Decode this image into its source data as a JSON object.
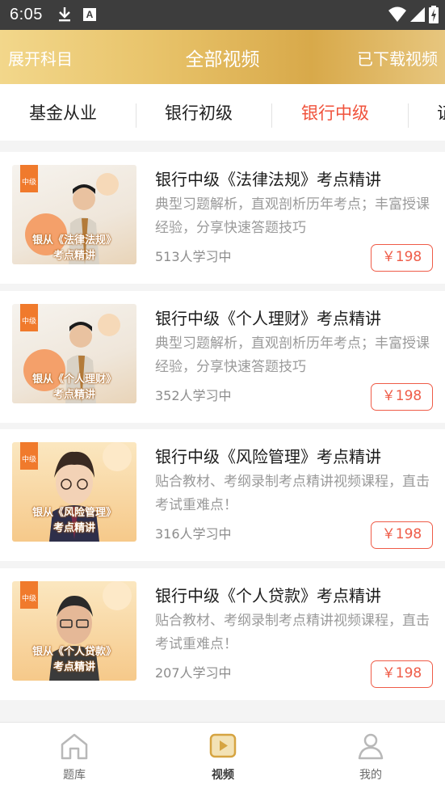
{
  "status_bar": {
    "time": "6:05",
    "notification_glyph": "A"
  },
  "header": {
    "left": "展开科目",
    "title": "全部视频",
    "right": "已下载视频"
  },
  "tabs": [
    {
      "label": "基金从业",
      "active": false
    },
    {
      "label": "银行初级",
      "active": false
    },
    {
      "label": "银行中级",
      "active": true
    },
    {
      "label": "证",
      "active": false
    }
  ],
  "courses": [
    {
      "level": "中级",
      "thumb_line1": "银从《法律法规》",
      "thumb_line2": "考点精讲",
      "title": "银行中级《法律法规》考点精讲",
      "desc": "典型习题解析，直观剖析历年考点；丰富授课经验，分享快速答题技巧",
      "count": "513人学习中",
      "price": "￥198"
    },
    {
      "level": "中级",
      "thumb_line1": "银从《个人理财》",
      "thumb_line2": "考点精讲",
      "title": "银行中级《个人理财》考点精讲",
      "desc": "典型习题解析，直观剖析历年考点；丰富授课经验，分享快速答题技巧",
      "count": "352人学习中",
      "price": "￥198"
    },
    {
      "level": "中级",
      "thumb_line1": "银从《风险管理》",
      "thumb_line2": "考点精讲",
      "title": "银行中级《风险管理》考点精讲",
      "desc": "贴合教材、考纲录制考点精讲视频课程，直击考试重难点！",
      "count": "316人学习中",
      "price": "￥198"
    },
    {
      "level": "中级",
      "thumb_line1": "银从《个人贷款》",
      "thumb_line2": "考点精讲",
      "title": "银行中级《个人贷款》考点精讲",
      "desc": "贴合教材、考纲录制考点精讲视频课程，直击考试重难点！",
      "count": "207人学习中",
      "price": "￥198"
    }
  ],
  "tabbar": [
    {
      "label": "题库",
      "icon": "question-bank-icon",
      "active": false
    },
    {
      "label": "视频",
      "icon": "video-icon",
      "active": true
    },
    {
      "label": "我的",
      "icon": "profile-icon",
      "active": false
    }
  ],
  "colors": {
    "accent": "#f0523b",
    "header_gold": "#d8a94a",
    "thumb_orange": "#f07a2c"
  }
}
